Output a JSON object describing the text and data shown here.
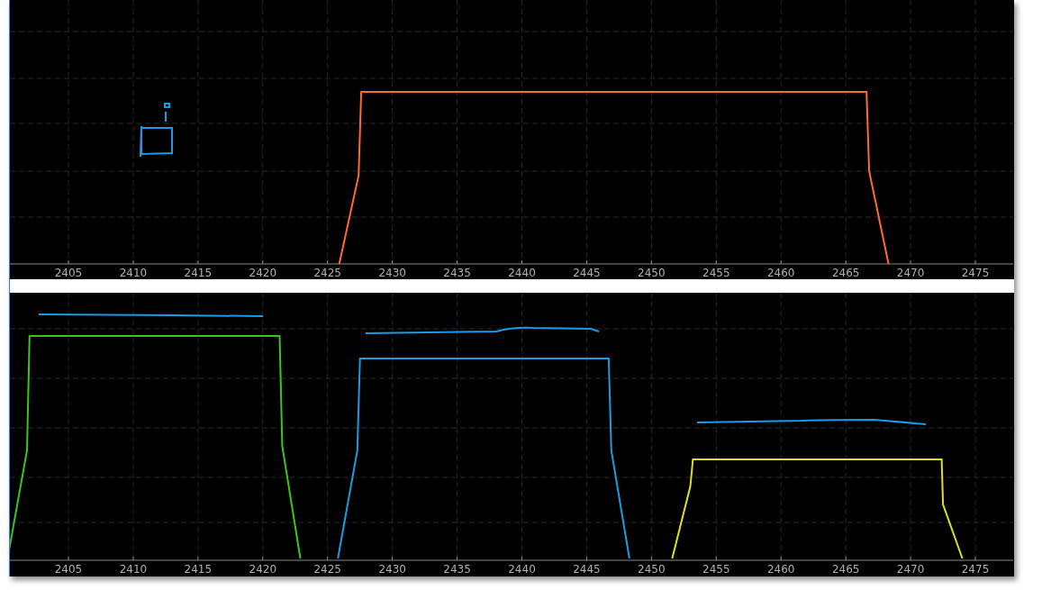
{
  "plots": [
    {
      "tick_labels": [
        "2405",
        "2410",
        "2415",
        "2420",
        "2425",
        "2430",
        "2435",
        "2440",
        "2445",
        "2450",
        "2455",
        "2460",
        "2465",
        "2470",
        "2475"
      ],
      "traces": [
        {
          "color": "#ff6a30"
        }
      ]
    },
    {
      "tick_labels": [
        "2405",
        "2410",
        "2415",
        "2420",
        "2425",
        "2430",
        "2435",
        "2440",
        "2445",
        "2450",
        "2455",
        "2460",
        "2465",
        "2470",
        "2475"
      ],
      "traces": [
        {
          "color": "#3cc51a"
        },
        {
          "color": "#1e9be0"
        },
        {
          "color": "#e0e020"
        }
      ]
    }
  ]
}
